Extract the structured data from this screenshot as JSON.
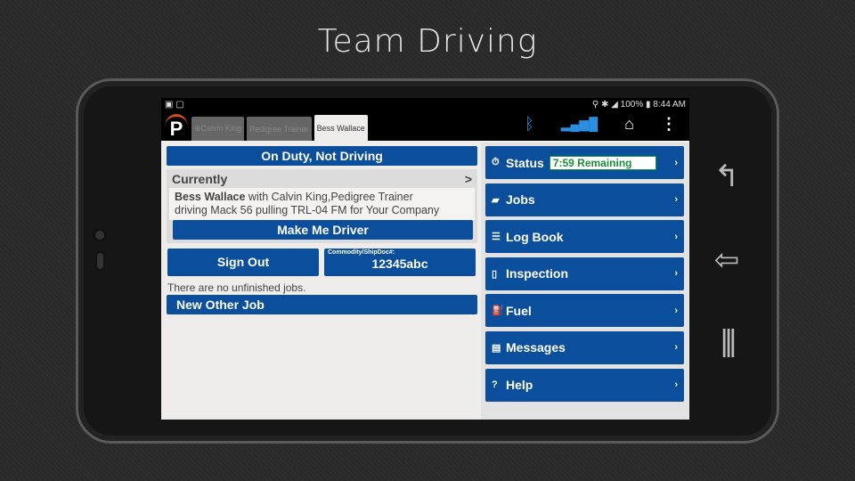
{
  "slide_title": "Team Driving",
  "status_bar": {
    "battery": "100%",
    "time": "8:44 AM"
  },
  "tabs": [
    {
      "label": "⊕Calvin King"
    },
    {
      "label": "Pedigree Trainer"
    },
    {
      "label": "Bess Wallace"
    }
  ],
  "left": {
    "duty_status": "On Duty, Not Driving",
    "currently_label": "Currently",
    "currently_chevron": ">",
    "driver_name": "Bess Wallace",
    "driver_info_rest": " with Calvin King,Pedigree Trainer",
    "driver_info_line2": "driving Mack 56 pulling TRL-04 FM for Your Company",
    "make_driver": "Make Me Driver",
    "sign_out": "Sign Out",
    "commodity_label": "Commodity/ShipDoc#:",
    "commodity_value": "12345abc",
    "no_jobs": "There are no unfinished jobs.",
    "new_job": "New Other Job"
  },
  "menu": {
    "status": "Status",
    "remaining": "7:59 Remaining",
    "items": [
      {
        "label": "Jobs"
      },
      {
        "label": "Log Book"
      },
      {
        "label": "Inspection"
      },
      {
        "label": "Fuel"
      },
      {
        "label": "Messages"
      },
      {
        "label": "Help"
      }
    ]
  },
  "colors": {
    "primary": "#0b4f9c",
    "remaining": "#1a8f3a"
  }
}
